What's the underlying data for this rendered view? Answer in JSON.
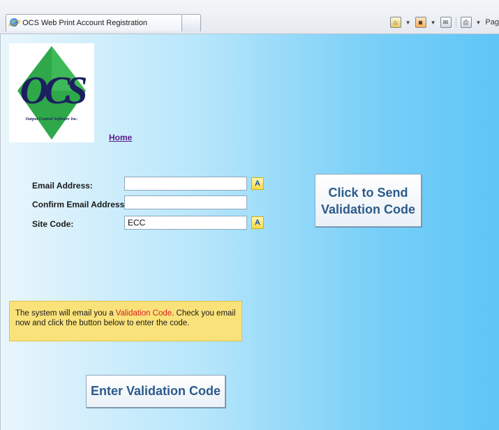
{
  "browser": {
    "tab_title": "OCS Web Print Account Registration",
    "page_menu_label": "Pag"
  },
  "logo": {
    "letters": "OCS",
    "company": "Output Control Software Inc."
  },
  "nav": {
    "home_label": "Home"
  },
  "form": {
    "email_label": "Email Address:",
    "email_value": "",
    "confirm_label": "Confirm Email Address:",
    "confirm_value": "",
    "site_label": "Site Code:",
    "site_value": "ECC",
    "help_glyph": "A"
  },
  "send_button": {
    "line1": "Click to Send",
    "line2": "Validation Code"
  },
  "notice": {
    "prefix": "The system will email you a ",
    "highlight": "Validation Code",
    "suffix": ". Check you email now and click the button below to enter the code."
  },
  "enter_button": {
    "label": "Enter Validation Code"
  },
  "colors": {
    "page_gradient_start": "#e9f6fc",
    "page_gradient_end": "#5fc6f6",
    "notice_bg": "#fae27a",
    "highlight_text": "#d42020",
    "button_text": "#2c5a8a",
    "logo_green": "#2fa84a",
    "logo_navy": "#1c1f5e"
  },
  "icons": [
    "ie-icon",
    "home-icon",
    "feeds-icon",
    "read-mail-icon",
    "print-icon",
    "help-icon"
  ]
}
